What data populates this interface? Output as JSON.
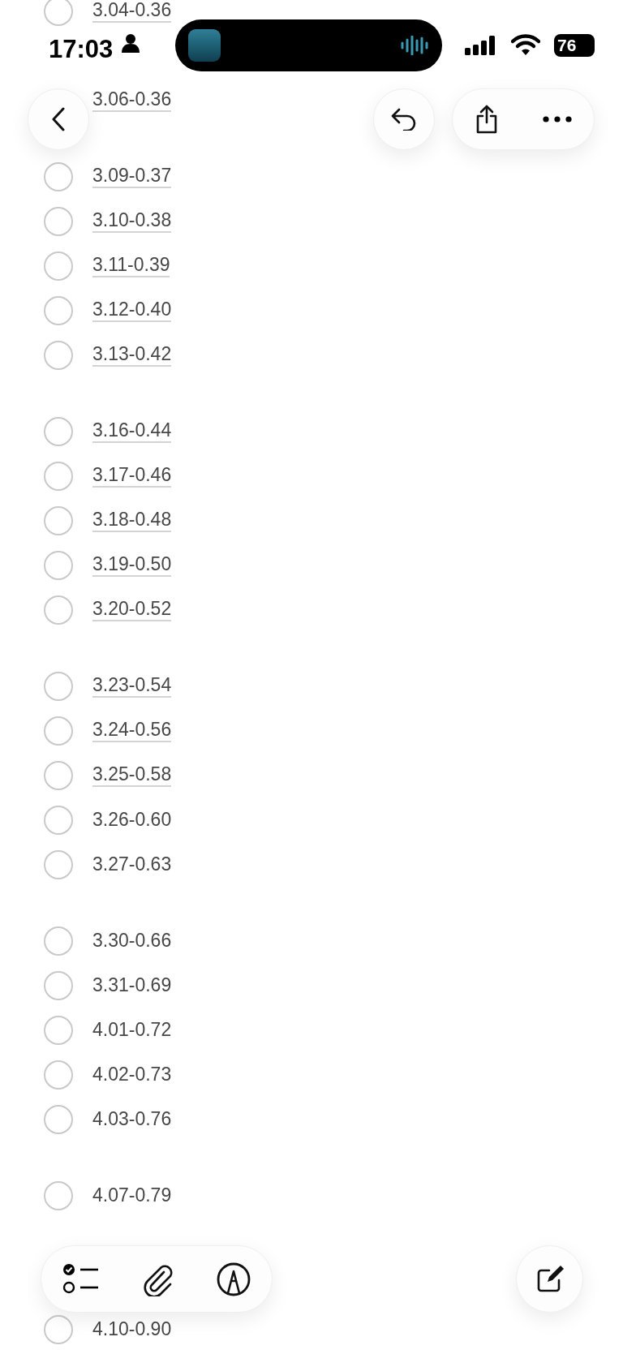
{
  "status_bar": {
    "time": "17:03",
    "battery": "76"
  },
  "groups": [
    {
      "items": [
        {
          "kind": "task",
          "text": "3.04-0.36",
          "checked": false,
          "linked": true
        },
        {
          "kind": "covered"
        },
        {
          "kind": "task-under-header",
          "text": "3.06-0.36",
          "linked": true
        }
      ]
    },
    {
      "items": [
        {
          "kind": "task",
          "text": "3.09-0.37",
          "checked": false,
          "linked": true
        },
        {
          "kind": "task",
          "text": "3.10-0.38",
          "checked": false,
          "linked": true
        },
        {
          "kind": "task",
          "text": "3.11-0.39",
          "checked": false,
          "linked": true
        },
        {
          "kind": "task",
          "text": "3.12-0.40",
          "checked": false,
          "linked": true
        },
        {
          "kind": "task",
          "text": "3.13-0.42",
          "checked": false,
          "linked": true
        }
      ]
    },
    {
      "items": [
        {
          "kind": "task",
          "text": "3.16-0.44",
          "checked": false,
          "linked": true
        },
        {
          "kind": "task",
          "text": "3.17-0.46",
          "checked": false,
          "linked": true
        },
        {
          "kind": "task",
          "text": "3.18-0.48",
          "checked": false,
          "linked": true
        },
        {
          "kind": "task",
          "text": "3.19-0.50",
          "checked": false,
          "linked": true
        },
        {
          "kind": "task",
          "text": "3.20-0.52",
          "checked": false,
          "linked": true
        }
      ]
    },
    {
      "items": [
        {
          "kind": "task",
          "text": "3.23-0.54",
          "checked": false,
          "linked": true
        },
        {
          "kind": "task",
          "text": "3.24-0.56",
          "checked": false,
          "linked": true
        },
        {
          "kind": "task",
          "text": "3.25-0.58",
          "checked": false,
          "linked": true
        },
        {
          "kind": "task",
          "text": "3.26-0.60",
          "checked": false,
          "linked": false
        },
        {
          "kind": "task",
          "text": "3.27-0.63",
          "checked": false,
          "linked": false
        }
      ]
    },
    {
      "items": [
        {
          "kind": "task",
          "text": "3.30-0.66",
          "checked": false,
          "linked": false
        },
        {
          "kind": "task",
          "text": "3.31-0.69",
          "checked": false,
          "linked": false
        },
        {
          "kind": "task",
          "text": "4.01-0.72",
          "checked": false,
          "linked": false
        },
        {
          "kind": "task",
          "text": "4.02-0.73",
          "checked": false,
          "linked": false
        },
        {
          "kind": "task",
          "text": "4.03-0.76",
          "checked": false,
          "linked": false
        }
      ]
    },
    {
      "items": [
        {
          "kind": "task",
          "text": "4.07-0.79",
          "checked": false,
          "linked": false
        },
        {
          "kind": "covered"
        },
        {
          "kind": "covered"
        },
        {
          "kind": "task",
          "text": "4.10-0.90",
          "checked": false,
          "linked": false
        }
      ]
    }
  ]
}
